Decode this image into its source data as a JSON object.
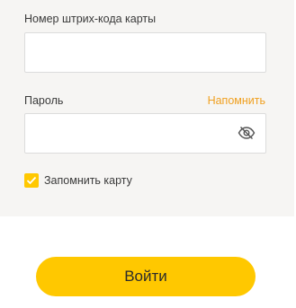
{
  "form": {
    "barcode_label": "Номер штрих-кода карты",
    "barcode_value": "",
    "password_label": "Пароль",
    "password_value": "",
    "remind_link": "Напомнить",
    "remember_label": "Запомнить карту",
    "remember_checked": true,
    "submit_label": "Войти"
  },
  "icons": {
    "password_visibility": "eye-slash-icon",
    "checkbox_mark": "check-icon"
  },
  "colors": {
    "accent": "#ffc800",
    "link": "#f0a020",
    "panel_bg": "#f6f5f3",
    "input_border": "#dcdcdc"
  }
}
